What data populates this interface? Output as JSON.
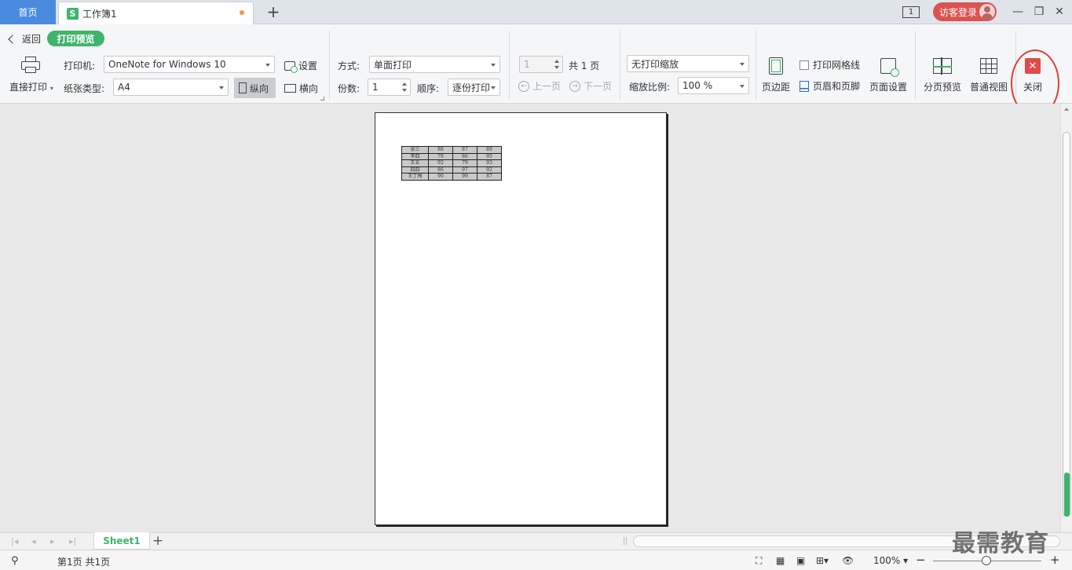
{
  "titlebar": {
    "home_tab": "首页",
    "doc_tab": "工作簿1",
    "doc_icon_letter": "S",
    "layout_badge": "1",
    "login_label": "访客登录"
  },
  "ribbon": {
    "back_label": "返回",
    "mode_badge": "打印预览",
    "direct_print": "直接打印",
    "printer_label": "打印机:",
    "printer_value": "OneNote for Windows 10",
    "paper_label": "纸张类型:",
    "paper_value": "A4",
    "setup_label": "设置",
    "portrait_label": "纵向",
    "landscape_label": "横向",
    "method_label": "方式:",
    "method_value": "单面打印",
    "copies_label": "份数:",
    "copies_value": "1",
    "order_label": "顺序:",
    "order_value": "逐份打印",
    "page_value": "1",
    "total_pages": "共 1 页",
    "prev_page": "上一页",
    "next_page": "下一页",
    "scale_mode": "无打印缩放",
    "scale_label": "缩放比例:",
    "scale_value": "100 %",
    "margin_btn": "页边距",
    "gridlines_label": "打印网格线",
    "header_footer_label": "页眉和页脚",
    "page_setup_btn": "页面设置",
    "page_break_btn": "分页预览",
    "normal_view_btn": "普通视图",
    "close_btn": "关闭"
  },
  "preview_table": [
    [
      "张三",
      "88",
      "87",
      "89"
    ],
    [
      "李四",
      "79",
      "86",
      "95"
    ],
    [
      "王五",
      "92",
      "79",
      "93"
    ],
    [
      "四四",
      "86",
      "97",
      "92"
    ],
    [
      "王丁梅",
      "90",
      "99",
      "87"
    ]
  ],
  "sheetbar": {
    "sheet_tab": "Sheet1"
  },
  "statusbar": {
    "page_info": "第1页 共1页",
    "zoom": "100%"
  },
  "watermark": "最需教育",
  "colors": {
    "accent_green": "#3fb46c",
    "home_tab_blue": "#4a8be0",
    "close_red": "#e14b4b",
    "login_red": "#d9534f"
  }
}
